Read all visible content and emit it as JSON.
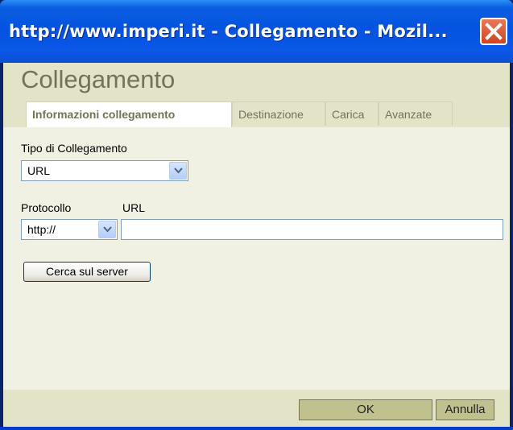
{
  "window": {
    "title": "http://www.imperi.it - Collegamento - Mozil..."
  },
  "dialog": {
    "title": "Collegamento",
    "tabs": [
      {
        "label": "Informazioni collegamento",
        "active": true
      },
      {
        "label": "Destinazione",
        "active": false
      },
      {
        "label": "Carica",
        "active": false
      },
      {
        "label": "Avanzate",
        "active": false
      }
    ]
  },
  "form": {
    "link_type_label": "Tipo di Collegamento",
    "link_type_value": "URL",
    "protocol_label": "Protocollo",
    "protocol_value": "http://",
    "url_label": "URL",
    "url_value": "",
    "browse_button": "Cerca sul server"
  },
  "footer": {
    "ok_label": "OK",
    "cancel_label": "Annulla"
  },
  "colors": {
    "titlebar": "#0553e0",
    "header_bg": "#e3e3c7",
    "body_bg": "#f1f1e3",
    "title_text": "#737357",
    "close_button": "#d1431f"
  }
}
